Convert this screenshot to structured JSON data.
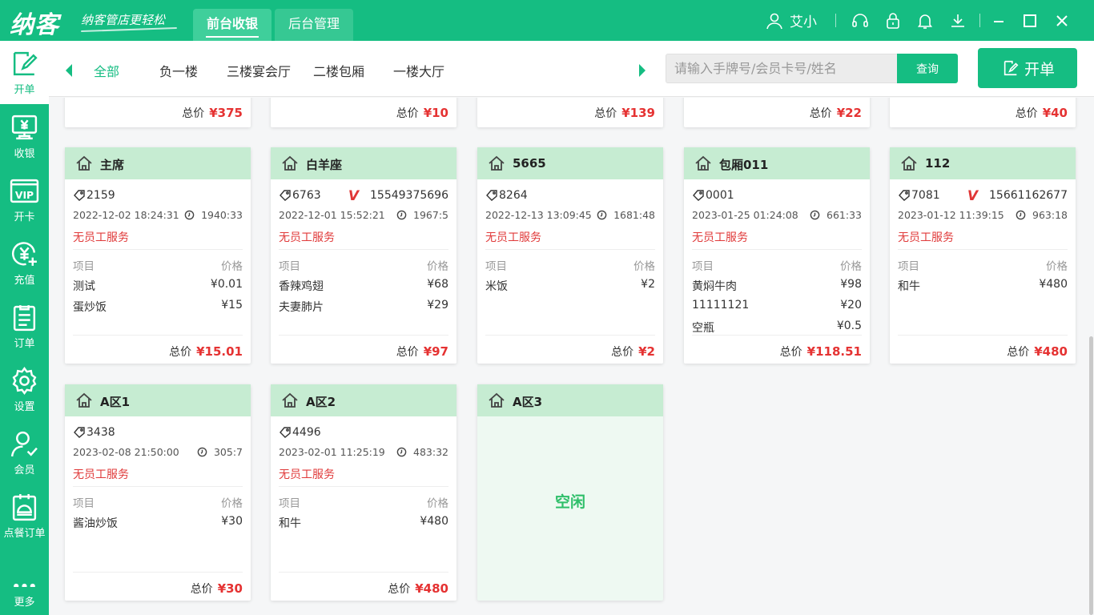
{
  "app": {
    "logo": "纳客",
    "slogan": "纳客管店更轻松",
    "top_tabs": [
      "前台收银",
      "后台管理"
    ],
    "user": "艾小"
  },
  "sidebar": {
    "items": [
      {
        "label": "开单",
        "icon": "edit-icon"
      },
      {
        "label": "收银",
        "icon": "cashier-icon"
      },
      {
        "label": "开卡",
        "icon": "vip-card-icon"
      },
      {
        "label": "充值",
        "icon": "recharge-icon"
      },
      {
        "label": "订单",
        "icon": "order-list-icon"
      },
      {
        "label": "设置",
        "icon": "gear-icon"
      },
      {
        "label": "会员",
        "icon": "member-icon"
      },
      {
        "label": "点餐订单",
        "icon": "dining-order-icon"
      },
      {
        "label": "更多",
        "icon": "more-icon"
      }
    ]
  },
  "nav": {
    "areas": [
      "全部",
      "负一楼",
      "三楼宴会厅",
      "二楼包厢",
      "一楼大厅"
    ],
    "search_placeholder": "请输入手牌号/会员卡号/姓名",
    "search_button": "查询",
    "open_button": "开单"
  },
  "labels": {
    "total": "总价",
    "item_col": "项目",
    "price_col": "价格",
    "no_staff": "无员工服务",
    "idle": "空闲"
  },
  "colors": {
    "brand": "#15bd82",
    "card_header": "#c6ecd2",
    "price_red": "#e53232"
  },
  "top_row_totals": [
    "¥375",
    "¥10",
    "¥139",
    "¥22",
    "¥40"
  ],
  "tables": [
    {
      "name": "主席",
      "tag": "2159",
      "phone": "",
      "vip": false,
      "time": "2022-12-02 18:24:31",
      "duration": "1940:33",
      "items": [
        {
          "name": "测试",
          "price": "¥0.01"
        },
        {
          "name": "蛋炒饭",
          "price": "¥15"
        }
      ],
      "total": "¥15.01"
    },
    {
      "name": "白羊座",
      "tag": "6763",
      "phone": "15549375696",
      "vip": true,
      "time": "2022-12-01 15:52:21",
      "duration": "1967:5",
      "items": [
        {
          "name": "香辣鸡翅",
          "price": "¥68"
        },
        {
          "name": "夫妻肺片",
          "price": "¥29"
        }
      ],
      "total": "¥97"
    },
    {
      "name": "5665",
      "tag": "8264",
      "phone": "",
      "vip": false,
      "time": "2022-12-13 13:09:45",
      "duration": "1681:48",
      "items": [
        {
          "name": "米饭",
          "price": "¥2"
        }
      ],
      "total": "¥2"
    },
    {
      "name": "包厢011",
      "tag": "0001",
      "phone": "",
      "vip": false,
      "time": "2023-01-25 01:24:08",
      "duration": "661:33",
      "items": [
        {
          "name": "黄焖牛肉",
          "price": "¥98"
        },
        {
          "name": "11111121",
          "price": "¥20"
        },
        {
          "name": "空瓶",
          "price": "¥0.5"
        }
      ],
      "total": "¥118.51"
    },
    {
      "name": "112",
      "tag": "7081",
      "phone": "15661162677",
      "vip": true,
      "time": "2023-01-12 11:39:15",
      "duration": "963:18",
      "items": [
        {
          "name": "和牛",
          "price": "¥480"
        }
      ],
      "total": "¥480"
    },
    {
      "name": "A区1",
      "tag": "3438",
      "phone": "",
      "vip": false,
      "time": "2023-02-08 21:50:00",
      "duration": "305:7",
      "items": [
        {
          "name": "酱油炒饭",
          "price": "¥30"
        }
      ],
      "total": "¥30"
    },
    {
      "name": "A区2",
      "tag": "4496",
      "phone": "",
      "vip": false,
      "time": "2023-02-01 11:25:19",
      "duration": "483:32",
      "items": [
        {
          "name": "和牛",
          "price": "¥480"
        }
      ],
      "total": "¥480"
    },
    {
      "name": "A区3",
      "idle": true
    }
  ]
}
